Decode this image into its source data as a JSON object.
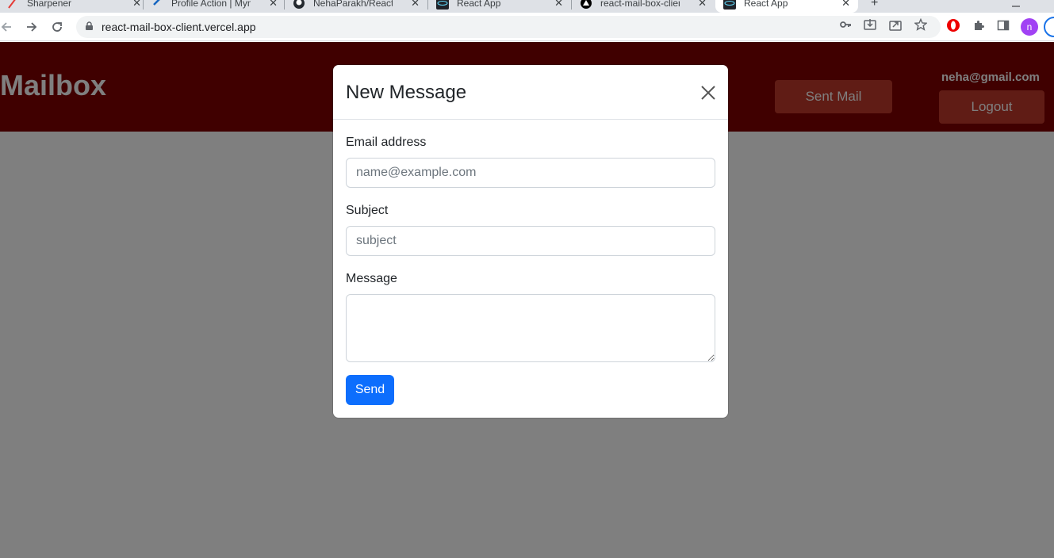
{
  "browser": {
    "tabs": [
      {
        "title": "Sharpener",
        "icon": "sharpener-favicon"
      },
      {
        "title": "Profile Action | Mynav",
        "icon": "arrow-favicon"
      },
      {
        "title": "NehaParakh/React-m",
        "icon": "github-favicon"
      },
      {
        "title": "React App",
        "icon": "react-favicon"
      },
      {
        "title": "react-mail-box-client",
        "icon": "vercel-favicon"
      },
      {
        "title": "React App",
        "icon": "react-favicon",
        "active": true
      }
    ],
    "close_glyph": "✕",
    "new_tab_glyph": "+",
    "url": "react-mail-box-client.vercel.app",
    "avatar_letter": "n"
  },
  "header": {
    "brand": "Mailbox",
    "sent_mail_label": "Sent Mail",
    "user_email": "neha@gmail.com",
    "logout_label": "Logout"
  },
  "modal": {
    "title": "New Message",
    "email_label": "Email address",
    "email_placeholder": "name@example.com",
    "email_value": "",
    "subject_label": "Subject",
    "subject_placeholder": "subject",
    "subject_value": "",
    "message_label": "Message",
    "message_value": "",
    "send_label": "Send"
  },
  "colors": {
    "header_bg": "#800000",
    "header_button_bg": "#c0392b",
    "primary": "#0d6efd",
    "backdrop": "rgba(0,0,0,0.5)"
  }
}
